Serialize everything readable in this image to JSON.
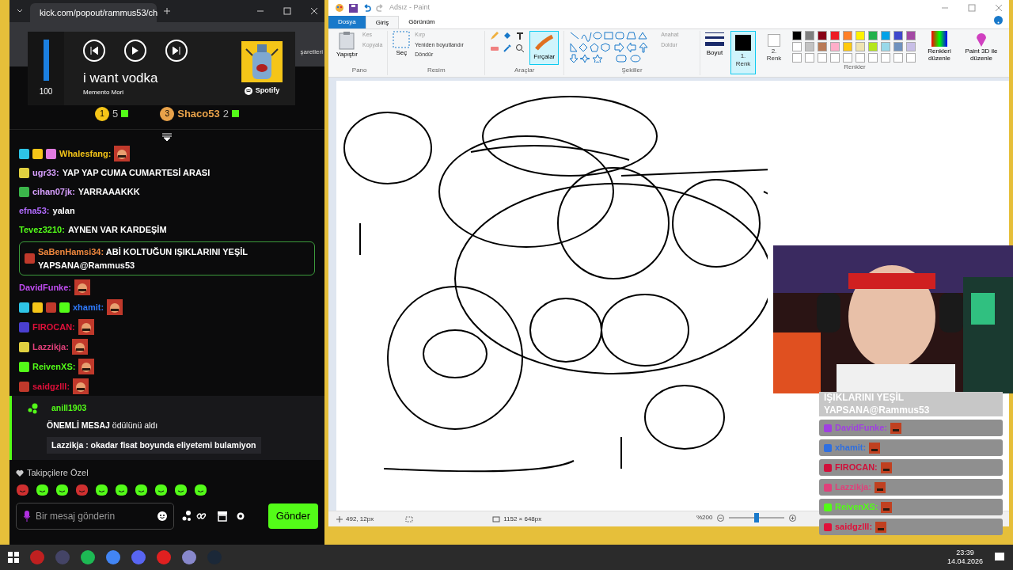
{
  "browser": {
    "tab_title": "kick.com/popout/rammus53/ch",
    "bookmarks": "şaretleri"
  },
  "media": {
    "level": 1,
    "volume": "100",
    "title": "i want vodka",
    "artist": "Memento Mori",
    "source": "Spotify"
  },
  "leaderboard": [
    {
      "rank": "1",
      "count": "5",
      "color": "#f5c518"
    },
    {
      "rank": "3",
      "name": "Shaco53",
      "count": "2",
      "color": "#e8a24a"
    }
  ],
  "messages": [
    {
      "user": "Whalesfang:",
      "color": "#f5c518",
      "badges": [
        {
          "color": "#2ec4e6"
        },
        {
          "color": "#f5c518"
        },
        {
          "color": "#e07be0"
        }
      ],
      "emote": true
    },
    {
      "user": "ugr33:",
      "color": "#d8a0ff",
      "badges": [
        {
          "color": "#e0d040"
        }
      ],
      "text": "YAP YAP CUMA CUMARTESİ ARASI"
    },
    {
      "user": "cihan07jk:",
      "color": "#d8a0ff",
      "badges": [
        {
          "color": "#3bb54a"
        }
      ],
      "text": "YARRAAAKKK"
    },
    {
      "user": "efna53:",
      "color": "#b26bff",
      "text": "yalan"
    },
    {
      "user": "Tevez3210:",
      "color": "#53fc18",
      "text": "AYNEN VAR KARDEŞİM"
    },
    {
      "user": "SaBenHamsi34:",
      "color": "#f0883e",
      "badges": [
        {
          "color": "#c0392b"
        }
      ],
      "text": "ABİ KOLTUĞUN IŞIKLARINI YEŞİL YAPSANA@Rammus53",
      "highlighted": true
    },
    {
      "user": "DavidFunke:",
      "color": "#c04cf0",
      "emote": true
    },
    {
      "user": "xhamit:",
      "color": "#2f7bff",
      "badges": [
        {
          "color": "#2ec4e6"
        },
        {
          "color": "#f5c518"
        },
        {
          "color": "#c0392b"
        },
        {
          "color": "#53fc18"
        }
      ],
      "emote": true
    },
    {
      "user": "FIROCAN:",
      "color": "#e0103a",
      "badges": [
        {
          "color": "#4a3fd0"
        }
      ],
      "emote": true
    },
    {
      "user": "Lazzikja:",
      "color": "#e0407a",
      "badges": [
        {
          "color": "#e0d040"
        }
      ],
      "emote": true
    },
    {
      "user": "ReivenXS:",
      "color": "#53fc18",
      "badges": [
        {
          "color": "#53fc18"
        }
      ],
      "emote": true
    },
    {
      "user": "saidgzlll:",
      "color": "#e0103a",
      "badges": [
        {
          "color": "#c0392b"
        }
      ],
      "emote": true
    }
  ],
  "reward": {
    "user": "anill1903",
    "text": "**ÖNEMLİ MESAJ** ödülünü aldı",
    "quote": "Lazzikja : okadar fisat boyunda eliyetemi bulamiyon"
  },
  "followers_label": "Takipçilere Özel",
  "composer": {
    "placeholder": "Bir mesaj gönderin",
    "send": "Gönder"
  },
  "paint": {
    "title": "Adsız - Paint",
    "tabs": [
      {
        "label": "Dosya",
        "kind": "file",
        "selected": false
      },
      {
        "label": "Giriş",
        "kind": "tab",
        "selected": true
      },
      {
        "label": "Görünüm",
        "kind": "tab",
        "selected": false
      }
    ],
    "clipboard": {
      "paste": "Yapıştır",
      "cut": "Kes",
      "copy": "Kopyala",
      "group": "Pano"
    },
    "image": {
      "select": "Seç",
      "crop": "Kırp",
      "resize": "Yeniden boyutlandır",
      "rotate": "Döndür",
      "group": "Resim"
    },
    "tools": {
      "group": "Araçlar",
      "brushes": "Fırçalar"
    },
    "shapes": {
      "outline": "Anahat",
      "fill": "Doldur",
      "group": "Şekiller"
    },
    "size": "Boyut",
    "color1": "1. Renk",
    "color2": "2. Renk",
    "palette": [
      {
        "color": "#000000"
      },
      {
        "color": "#7f7f7f"
      },
      {
        "color": "#880015"
      },
      {
        "color": "#ed1c24"
      },
      {
        "color": "#ff7f27"
      },
      {
        "color": "#fff200"
      },
      {
        "color": "#22b14c"
      },
      {
        "color": "#00a2e8"
      },
      {
        "color": "#3f48cc"
      },
      {
        "color": "#a349a4"
      },
      {
        "color": "#ffffff"
      },
      {
        "color": "#c3c3c3"
      },
      {
        "color": "#b97a57"
      },
      {
        "color": "#ffaec9"
      },
      {
        "color": "#ffc90e"
      },
      {
        "color": "#efe4b0"
      },
      {
        "color": "#b5e61d"
      },
      {
        "color": "#99d9ea"
      },
      {
        "color": "#7092be"
      },
      {
        "color": "#c8bfe7"
      }
    ],
    "edit_colors": "Renkleri düzenle",
    "paint3d": "Paint 3D ile düzenle",
    "colors_group": "Renkler",
    "status": {
      "position": "492, 12px",
      "size": "1152 × 648px",
      "zoom": "%200",
      "level": 0.5
    }
  },
  "overlay": {
    "highlight": "IŞIKLARINI YEŞİL YAPSANA@Rammus53",
    "messages": [
      {
        "user": "DavidFunke:",
        "color": "#a040e0"
      },
      {
        "user": "xhamit:",
        "color": "#2f6fe0"
      },
      {
        "user": "FIROCAN:",
        "color": "#d0103a"
      },
      {
        "user": "Lazzikja:",
        "color": "#e0407a"
      },
      {
        "user": "ReivenXS:",
        "color": "#53fc18"
      },
      {
        "user": "saidgzlll:",
        "color": "#e0103a"
      }
    ]
  },
  "taskbar": {
    "time": "23:39",
    "date": "14.04.2026"
  }
}
